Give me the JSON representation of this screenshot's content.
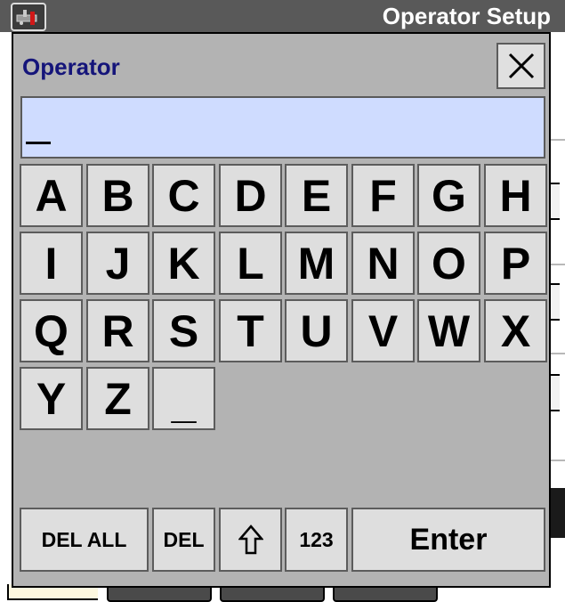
{
  "titlebar": {
    "title": "Operator Setup",
    "icon": "operator-setup-icon"
  },
  "dialog": {
    "title": "Operator",
    "close_label": "X",
    "close_icon": "close-icon"
  },
  "input": {
    "value": "_"
  },
  "keyboard": {
    "rows": [
      [
        "A",
        "B",
        "C",
        "D",
        "E",
        "F",
        "G",
        "H"
      ],
      [
        "I",
        "J",
        "K",
        "L",
        "M",
        "N",
        "O",
        "P"
      ],
      [
        "Q",
        "R",
        "S",
        "T",
        "U",
        "V",
        "W",
        "X"
      ],
      [
        "Y",
        "Z",
        "_"
      ]
    ],
    "function_keys": {
      "del_all": "DEL ALL",
      "del": "DEL",
      "shift_icon": "shift-arrow-icon",
      "numeric": "123",
      "enter": "Enter"
    }
  },
  "colors": {
    "title_bar": "#595959",
    "dialog_bg": "#b3b3b3",
    "dialog_title": "#15157a",
    "input_bg": "#cfdcff",
    "key_bg": "#dedede"
  }
}
